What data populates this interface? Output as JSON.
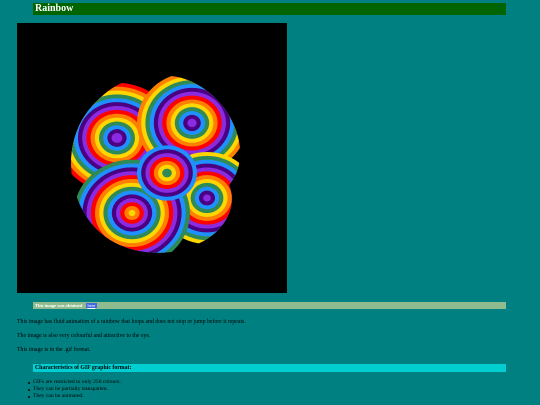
{
  "page": {
    "title": "Rainbow"
  },
  "image": {
    "icon": "rainbow-ball-gif",
    "background": "#000000",
    "stripe_colors": [
      "#ff0000",
      "#ff7f00",
      "#ffd700",
      "#2e8b57",
      "#1e90ff",
      "#4b0082",
      "#8a2be2"
    ]
  },
  "credit": {
    "text": "This image was obtained",
    "link_label": "here"
  },
  "description": {
    "paragraph1": "This image has fluid animation of a rainbow that loops and does not stop or jump before it repeats.",
    "paragraph2": "The image is also very colourful and attractive to the eye.",
    "paragraph3": "This image is in the .gif format."
  },
  "features": {
    "heading": "Characteristics of GIF graphic format:",
    "items": [
      "GIFs are restricted to only 256 colours.",
      "They can be partially transparent.",
      "They can be animated."
    ]
  },
  "colors": {
    "page_background": "#008080",
    "title_bar": "#006400",
    "credit_bar": "#8fbc8f",
    "features_bar": "#00ced1",
    "link": "#4169e1"
  }
}
